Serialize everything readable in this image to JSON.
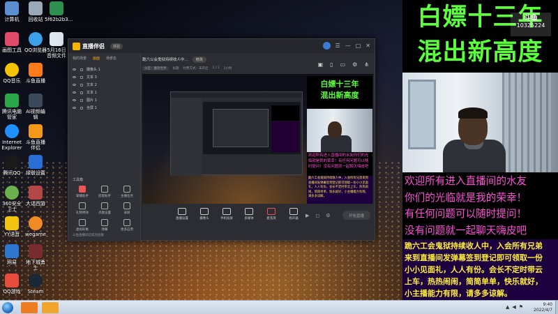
{
  "desktop": {
    "icons": [
      {
        "label": "计算机"
      },
      {
        "label": "回收站"
      },
      {
        "label": "5f62b2b3..."
      },
      {
        "label": "画图工具"
      },
      {
        "label": "QQ浏览器"
      },
      {
        "label": "5月16日音频文件"
      },
      {
        "label": "QQ音乐"
      },
      {
        "label": "斗鱼直播"
      },
      {
        "label": "腾讯电脑管家"
      },
      {
        "label": "AI视频编辑"
      },
      {
        "label": "Internet Explorer"
      },
      {
        "label": "斗鱼直播伴侣"
      },
      {
        "label": "腾讯QQ"
      },
      {
        "label": "绿联设置"
      },
      {
        "label": "360安全卫士"
      },
      {
        "label": "大话西游"
      },
      {
        "label": "YY语音"
      },
      {
        "label": "wegame"
      },
      {
        "label": "网易"
      },
      {
        "label": "地下城勇士"
      },
      {
        "label": "QQ游戏"
      },
      {
        "label": "Steam"
      }
    ]
  },
  "app": {
    "title": "直播伴侣",
    "version": "体验",
    "scene_tabs": [
      "我的场景",
      "画面",
      "场景名"
    ],
    "sources": [
      "摄像头 1",
      "文本 3",
      "文本 2",
      "文本 1",
      "图片 1",
      "全屏 1"
    ],
    "tools_title": "工具箱",
    "tools": [
      {
        "label": "掌播助手"
      },
      {
        "label": "房管助手"
      },
      {
        "label": "主播任务"
      },
      {
        "label": "礼物特效"
      },
      {
        "label": "点歌设置"
      },
      {
        "label": "录屏"
      },
      {
        "label": "虚拟形象"
      },
      {
        "label": "弹幕"
      },
      {
        "label": "更多应用"
      }
    ],
    "chat_notice": "斗鱼直播间已成功连接",
    "stream_title": "跪六公会鬼狱持续收人中...",
    "stream_title_button": "修改",
    "stream_sub": [
      "分区：魔兽世界",
      "标题",
      "付费方式：未开启",
      "1 / 1",
      "1小时"
    ],
    "preview_title_lines": [
      "白嫖十三年",
      "混出新高度"
    ],
    "preview_welcome": "欢迎所有进入直播间的水友你们的光临就是我的荣幸！有任何问题可以随时提问！没有问题就一起聊天嗨皮吧",
    "preview_notice": "跪六工会鬼狱持续收人中，入会所有兄弟来到直播间发弹幕签到登记即可领取一份小小见面礼，人人有份。会长不定时带云上车，热热闹闹，简简单单，快乐就好，小主播能力有限，请多多谅解。",
    "bottom_tools": [
      {
        "label": "直播设置"
      },
      {
        "label": "摄像头"
      },
      {
        "label": "手机投屏"
      },
      {
        "label": "多媒体"
      },
      {
        "label": "麦克风"
      },
      {
        "label": "扬声器"
      }
    ],
    "start_button": "开始直播"
  },
  "overlay": {
    "title_lines": [
      "白嫖十三年",
      "混出新高度"
    ],
    "room_brand": "斗鱼",
    "room_id": "10325224",
    "welcome_lines": [
      "欢迎所有进入直播间的水友",
      "你们的光临就是我的荣幸！",
      "有任何问题可以随时提问！",
      "没有问题就一起聊天嗨皮吧"
    ],
    "notice_lines": [
      "跪六工会鬼狱持续收人中，入会所有兄弟",
      "来到直播间发弹幕签到登记即可领取一份",
      "小小见面礼，人人有份。会长不定时带云",
      "上车，热热闹闹，简简单单，快乐就好，",
      "小主播能力有限，请多多谅解。"
    ]
  },
  "taskbar": {
    "time": "9:40",
    "date": "2022/4/7"
  }
}
